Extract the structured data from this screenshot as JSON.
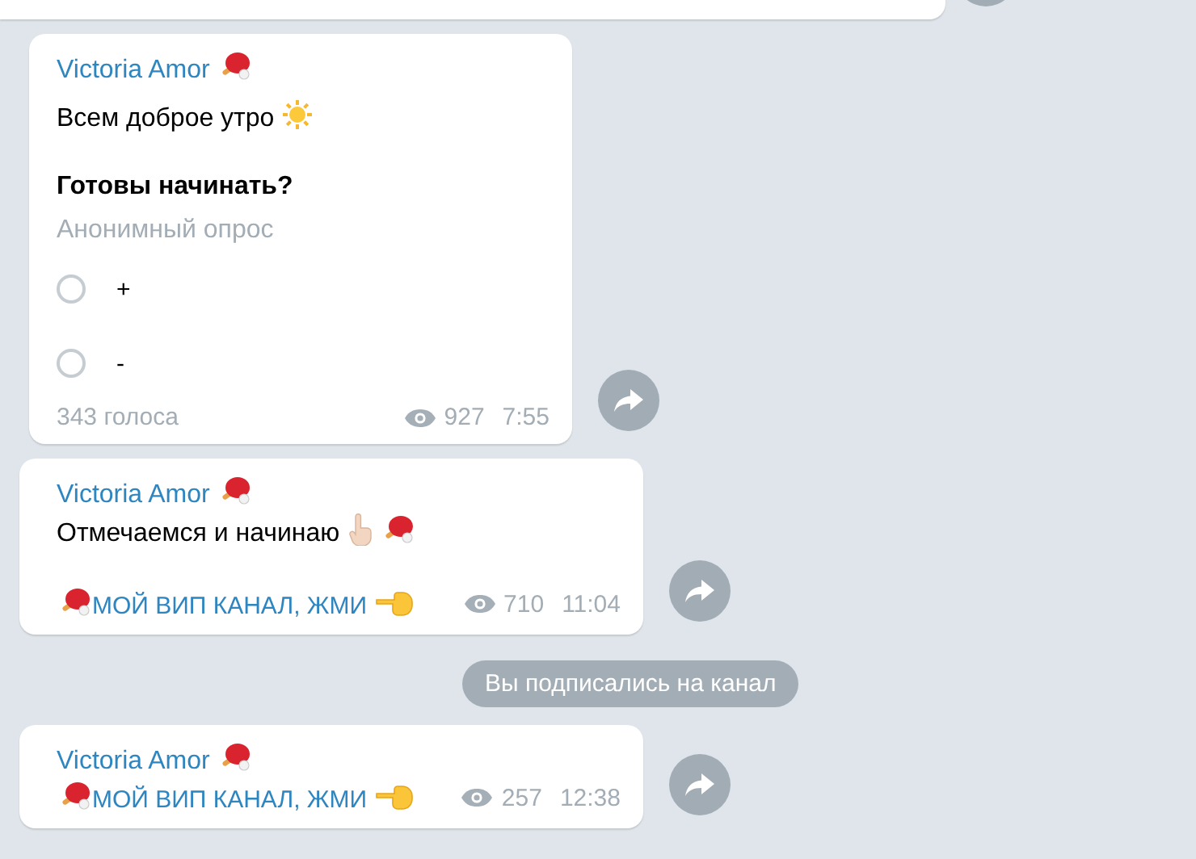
{
  "messages": [
    {
      "kind": "cut",
      "forward": true
    },
    {
      "kind": "poll",
      "author": "Victoria Amor",
      "text": "Всем доброе утро",
      "question": "Готовы начинать?",
      "poll_type": "Анонимный опрос",
      "options": [
        {
          "label": "+",
          "selected": false
        },
        {
          "label": "-",
          "selected": false
        }
      ],
      "votes": "343 голоса",
      "views": "927",
      "time": "7:55",
      "forward": true
    },
    {
      "kind": "text",
      "author": "Victoria Amor",
      "text": "Отмечаемся и начинаю",
      "link": "МОЙ ВИП КАНАЛ, ЖМИ",
      "views": "710",
      "time": "11:04",
      "forward": true
    },
    {
      "kind": "service",
      "text": "Вы подписались на канал"
    },
    {
      "kind": "text",
      "author": "Victoria Amor",
      "link": "МОЙ ВИП КАНАЛ, ЖМИ",
      "views": "257",
      "time": "12:38",
      "forward": true
    }
  ]
}
